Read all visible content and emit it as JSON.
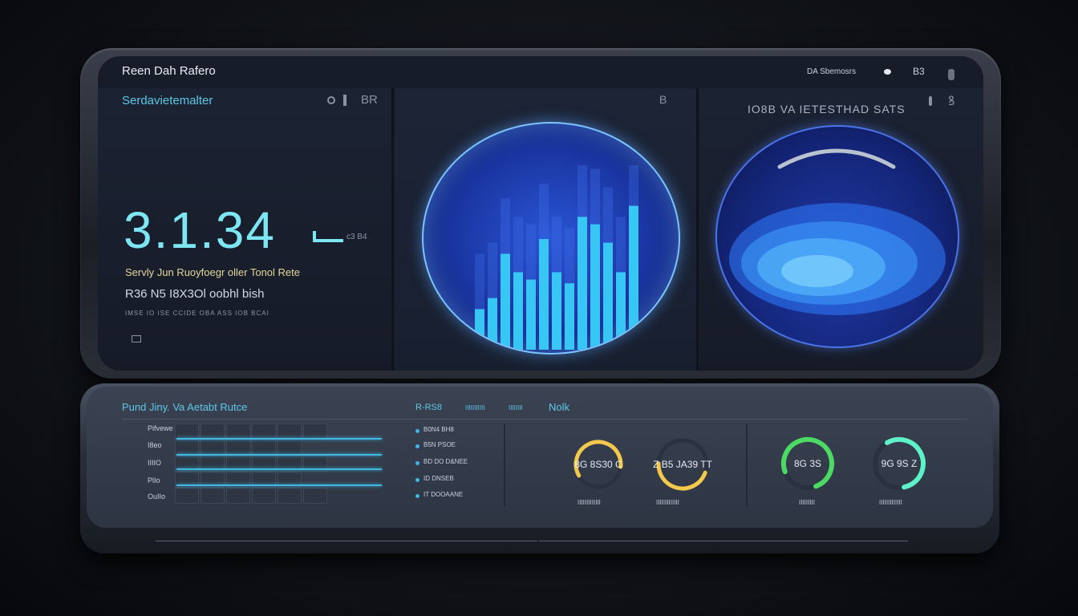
{
  "top": {
    "window_title": "Reen Dah Rafero",
    "status_text": "DA Sbemosrs",
    "status_icon_label": "B3",
    "panel1": {
      "heading": "Serdavietemalter",
      "toolbar_label": "BR",
      "big_value": "3.1.34",
      "value_suffix": "c3 B4",
      "subtitle": "Servly Jun Ruoyfoegr oller Tonol Rete",
      "detail": "R36 N5 I8X3Ol oobhl bish",
      "fine_print": "IMSE IO ISE CCIDE OBA ASS IOB BCAI",
      "footer_icon": "list-icon"
    },
    "panel2": {
      "toolbar_label": "B",
      "chart_data": {
        "type": "bar",
        "bar_values": [
          0.22,
          0.28,
          0.52,
          0.42,
          0.38,
          0.6,
          0.42,
          0.36,
          0.72,
          0.68,
          0.58,
          0.42,
          0.78
        ],
        "bar_color": "#38c6f5"
      }
    },
    "panel3": {
      "heading": "IO8B VA IETESTHAD SATS",
      "icon_label": "ꝸ"
    }
  },
  "bottom": {
    "title": "Pund Jiny. Va Aetabt Rutce",
    "tabs": [
      "R-RS8",
      "IIIIIIIIIII",
      "IIIIIIII",
      "Nolk"
    ],
    "row_labels": [
      "Pifvewe",
      "I8eo",
      "IIIIO",
      "PlIo",
      "OuIIo"
    ],
    "legend": [
      "B0N4 BH8",
      "B5N PSOE",
      "BD DO D&NEE",
      "ID DNSEB",
      "IT DOOAANE"
    ],
    "gauges": [
      {
        "label": "8G 8S30 C",
        "color": "#f2c94c",
        "accent": "#3a7bd5",
        "caption": "IIIIIIIIIIIII",
        "level": 0.6
      },
      {
        "label": "Z B5 JA39 TT",
        "color": "#f2c94c",
        "accent": "#c8d0da",
        "caption": "IIIIIIIIIIIII",
        "level": 0.45
      },
      {
        "label": "8G 3S",
        "color": "#4cd964",
        "accent": "#2f6bff",
        "caption": "IIIIIIIII",
        "level": 0.75
      },
      {
        "label": "9G 9S Z",
        "color": "#5ef2c8",
        "accent": "#c8d0da",
        "caption": "IIIIIIIIIIIII",
        "level": 0.55
      }
    ]
  },
  "colors": {
    "accent": "#5cc8e6",
    "background": "#161c28",
    "bars": "#38c6f5"
  }
}
